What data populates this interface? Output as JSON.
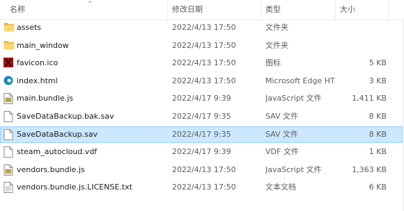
{
  "columns": {
    "name": "名称",
    "date": "修改日期",
    "type": "类型",
    "size": "大小"
  },
  "files": [
    {
      "name": "assets",
      "date": "2022/4/13 17:50",
      "type": "文件夹",
      "size": "",
      "icon": "folder-icon",
      "selected": false
    },
    {
      "name": "main_window",
      "date": "2022/4/13 17:50",
      "type": "文件夹",
      "size": "",
      "icon": "folder-icon",
      "selected": false
    },
    {
      "name": "favicon.ico",
      "date": "2022/4/13 17:50",
      "type": "图标",
      "size": "5 KB",
      "icon": "favicon-icon",
      "selected": false
    },
    {
      "name": "index.html",
      "date": "2022/4/13 17:50",
      "type": "Microsoft Edge HT...",
      "size": "3 KB",
      "icon": "edge-icon",
      "selected": false
    },
    {
      "name": "main.bundle.js",
      "date": "2022/4/17 9:39",
      "type": "JavaScript 文件",
      "size": "1,411 KB",
      "icon": "js-file-icon",
      "selected": false
    },
    {
      "name": "SaveDataBackup.bak.sav",
      "date": "2022/4/17 9:35",
      "type": "SAV 文件",
      "size": "8 KB",
      "icon": "file-icon",
      "selected": false
    },
    {
      "name": "SaveDataBackup.sav",
      "date": "2022/4/17 9:35",
      "type": "SAV 文件",
      "size": "8 KB",
      "icon": "file-icon",
      "selected": true
    },
    {
      "name": "steam_autocloud.vdf",
      "date": "2022/4/17 9:39",
      "type": "VDF 文件",
      "size": "1 KB",
      "icon": "file-icon",
      "selected": false
    },
    {
      "name": "vendors.bundle.js",
      "date": "2022/4/13 17:50",
      "type": "JavaScript 文件",
      "size": "1,363 KB",
      "icon": "js-file-icon",
      "selected": false
    },
    {
      "name": "vendors.bundle.js.LICENSE.txt",
      "date": "2022/4/13 17:50",
      "type": "文本文档",
      "size": "6 KB",
      "icon": "text-file-icon",
      "selected": false
    }
  ]
}
